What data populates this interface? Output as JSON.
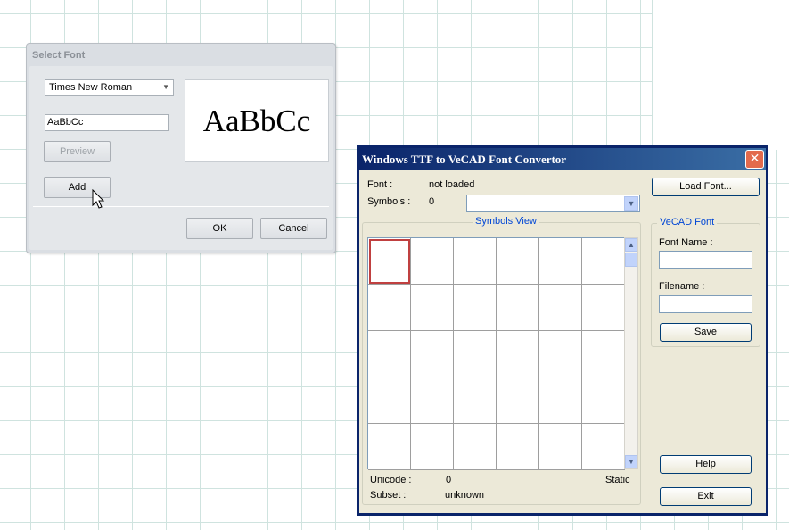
{
  "select_font_dialog": {
    "title": "Select Font",
    "font_select": "Times New Roman",
    "sample_input": "AaBbCc",
    "preview_button": "Preview",
    "preview_text": "AaBbCc",
    "add_button": "Add",
    "ok_button": "OK",
    "cancel_button": "Cancel"
  },
  "converter_dialog": {
    "title": "Windows TTF to VeCAD Font Convertor",
    "font_label": "Font :",
    "font_value": "not loaded",
    "symbols_label": "Symbols :",
    "symbols_value": "0",
    "symbols_combo": "",
    "symbols_view_title": "Symbols View",
    "unicode_label": "Unicode :",
    "unicode_value": "0",
    "static_label": "Static",
    "subset_label": "Subset :",
    "subset_value": "unknown",
    "load_font_button": "Load Font...",
    "vecad_group_title": "VeCAD Font",
    "font_name_label": "Font Name :",
    "font_name_value": "",
    "filename_label": "Filename :",
    "filename_value": "",
    "save_button": "Save",
    "help_button": "Help",
    "exit_button": "Exit"
  },
  "colors": {
    "titlebar_start": "#0a246a",
    "titlebar_end": "#3a6ea5",
    "group_title": "#0046d5",
    "selected_cell": "#c04040"
  }
}
